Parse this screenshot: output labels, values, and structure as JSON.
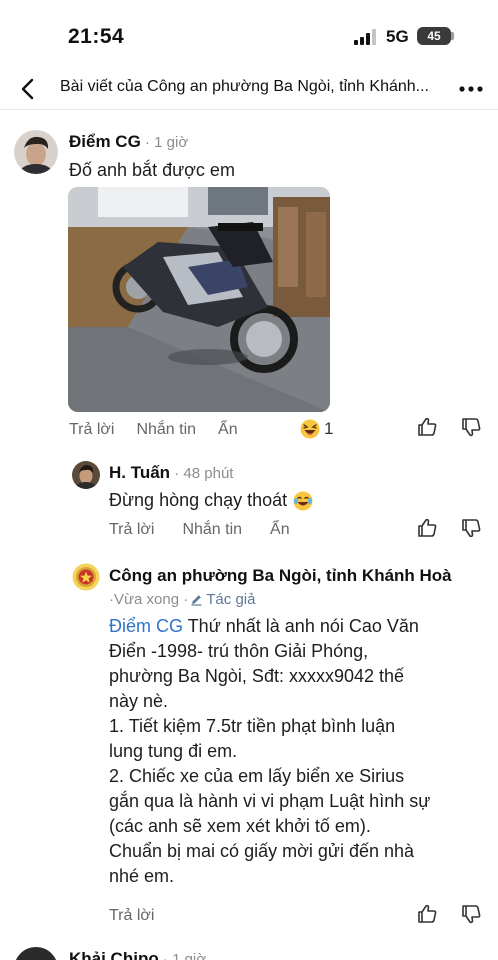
{
  "status": {
    "time": "21:54",
    "network": "5G",
    "battery": "45"
  },
  "header": {
    "title": "Bài viết của Công an phường Ba Ngòi, tỉnh Khánh...",
    "back_icon": "chevron-left-icon",
    "more_icon": "more-horizontal-icon"
  },
  "comments": [
    {
      "author": "Điểm CG",
      "time": "1 giờ",
      "text": "Đố anh bắt được em",
      "actions": {
        "reply": "Trả lời",
        "message": "Nhắn tin",
        "hide": "Ẩn"
      },
      "reaction_count": "1",
      "reaction_icon": "laughing-face-icon"
    },
    {
      "author": "H. Tuấn",
      "time": "48 phút",
      "text": "Đừng hòng chạy thoát",
      "actions": {
        "reply": "Trả lời",
        "message": "Nhắn tin",
        "hide": "Ẩn"
      }
    },
    {
      "author": "Công an phường Ba Ngòi, tỉnh Khánh Hoà",
      "time": "Vừa xong",
      "tag_label": "Tác giả",
      "mention": "Điểm CG",
      "lines": [
        " Thứ nhất là anh nói Cao Văn",
        "Điển -1998- trú thôn Giải Phóng,",
        "phường Ba Ngòi, Sđt: xxxxx9042 thế",
        "này nè.",
        "1. Tiết kiệm 7.5tr tiền phạt bình luận",
        "lung tung đi em.",
        "2. Chiếc xe của em lấy biển xe Sirius",
        "gắn qua là hành vi vi phạm Luật hình sự",
        "(các anh sẽ xem xét khởi tố em).",
        "Chuẩn bị mai có giấy mời gửi đến nhà",
        "nhé em."
      ],
      "actions": {
        "reply": "Trả lời"
      }
    },
    {
      "author": "Khải Chipo",
      "time": "1 giờ"
    }
  ]
}
